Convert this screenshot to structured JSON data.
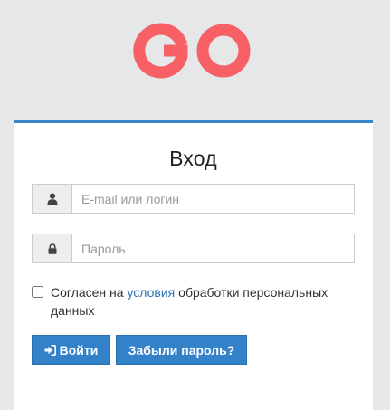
{
  "brand": {
    "logo_text": "GO",
    "logo_color": "#f76166"
  },
  "login": {
    "title": "Вход",
    "email_placeholder": "E-mail или логин",
    "password_placeholder": "Пароль",
    "agree": {
      "prefix": "Согласен на ",
      "link_text": "условия",
      "suffix": " обработки персональных данных",
      "checked": false
    },
    "login_button": "Войти",
    "forgot_button": "Забыли пароль?",
    "icons": {
      "email": "user-icon",
      "password": "lock-icon",
      "login": "sign-in-icon"
    }
  },
  "colors": {
    "accent": "#3381c9",
    "link": "#2a72b5",
    "background": "#e6e7e9"
  }
}
